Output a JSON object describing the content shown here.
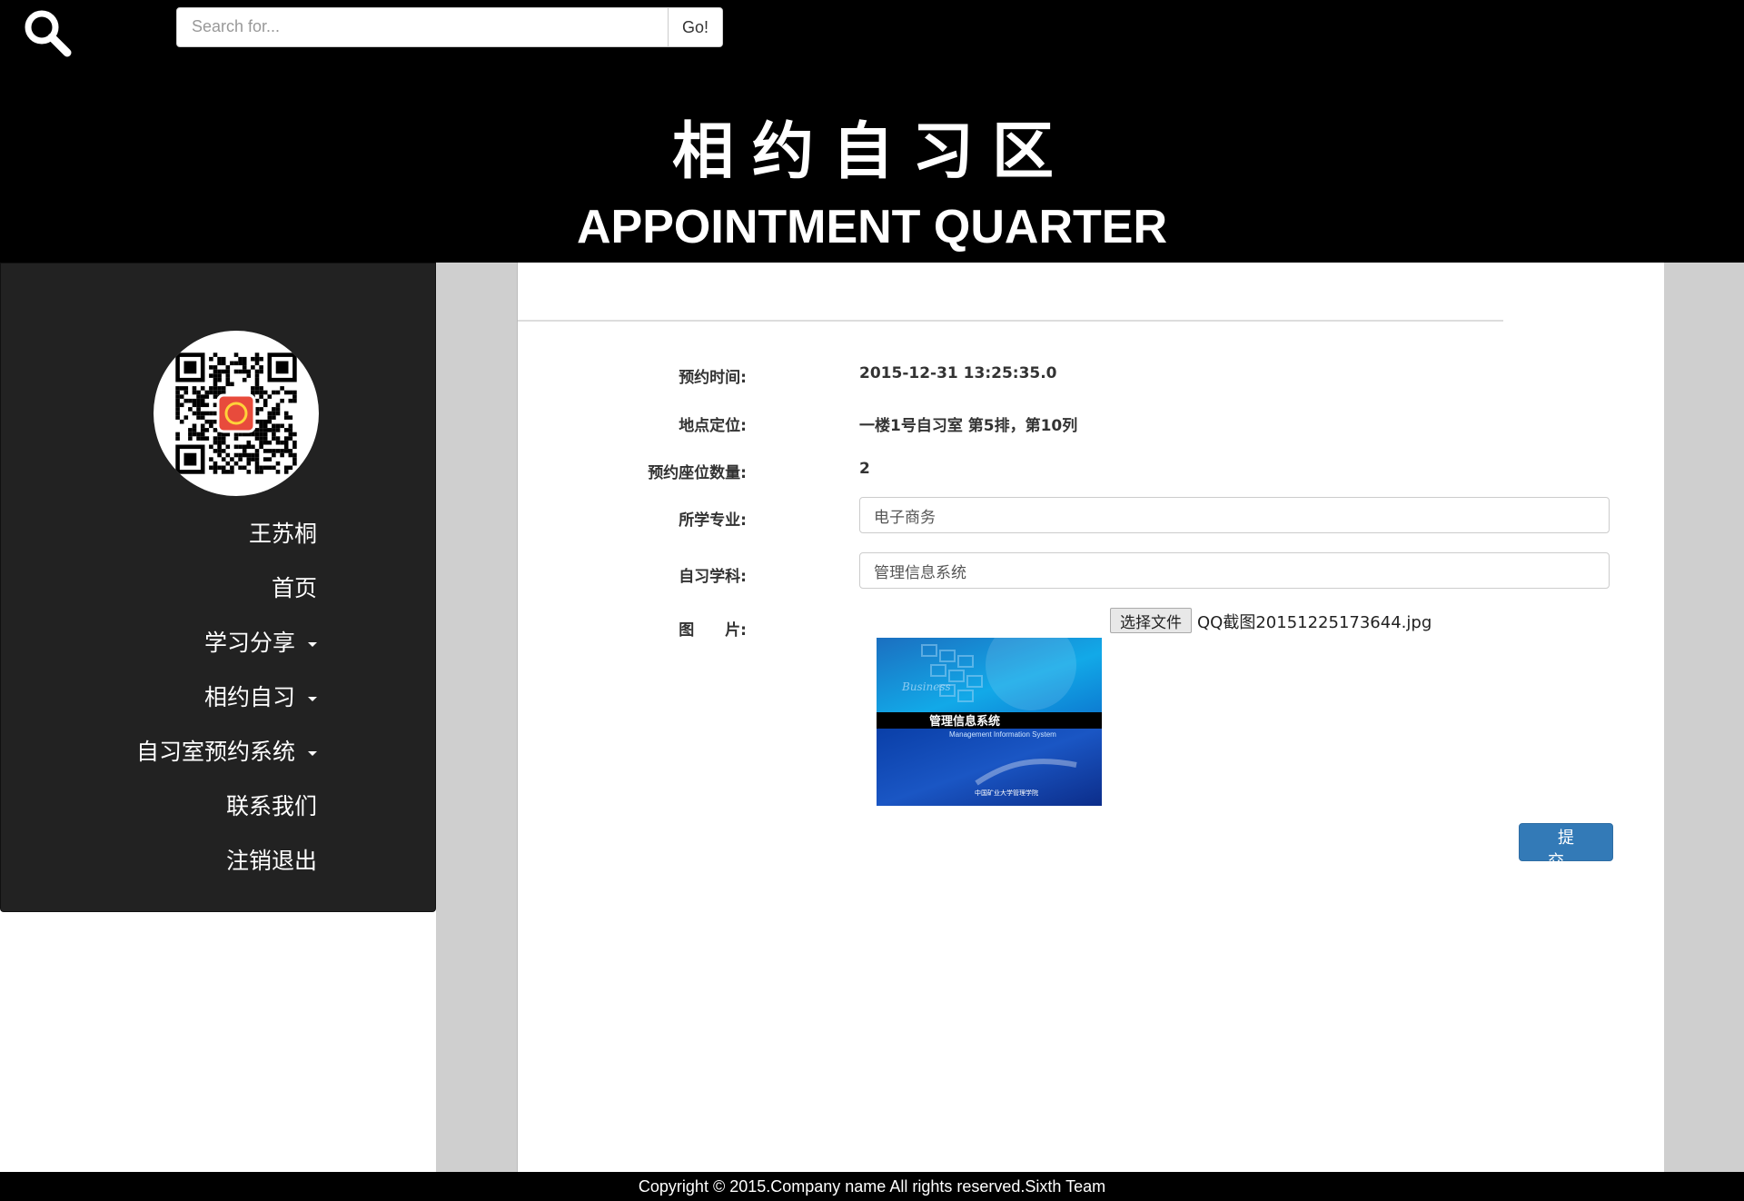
{
  "search": {
    "placeholder": "Search for...",
    "button_label": "Go!"
  },
  "header": {
    "title_cn": "相约自习区",
    "title_en": "APPOINTMENT QUARTER"
  },
  "sidebar": {
    "user_name": "王苏桐",
    "items": [
      {
        "label": "首页",
        "has_dropdown": false
      },
      {
        "label": "学习分享",
        "has_dropdown": true
      },
      {
        "label": "相约自习",
        "has_dropdown": true
      },
      {
        "label": "自习室预约系统",
        "has_dropdown": true
      },
      {
        "label": "联系我们",
        "has_dropdown": false
      },
      {
        "label": "注销退出",
        "has_dropdown": false
      }
    ]
  },
  "form": {
    "time_label": "预约时间:",
    "time_value": "2015-12-31 13:25:35.0",
    "location_label": "地点定位:",
    "location_value": "一楼1号自习室 第5排，第10列",
    "seats_label": "预约座位数量:",
    "seats_value": "2",
    "major_label": "所学专业:",
    "major_value": "电子商务",
    "subject_label": "自习学科:",
    "subject_value": "管理信息系统",
    "image_label": "图　　片:",
    "file_button_label": "选择文件",
    "file_name": "QQ截图20151225173644.jpg",
    "preview": {
      "title": "管理信息系统",
      "subtitle": "Management Information System",
      "footer": "中国矿业大学管理学院",
      "corner_text": "Business"
    },
    "submit_label": "提交"
  },
  "footer": {
    "copyright": "Copyright © 2015.Company name All rights reserved.Sixth Team"
  },
  "colors": {
    "header_bg": "#000000",
    "sidebar_bg": "#222222",
    "submit_bg": "#337ab7",
    "page_bg": "#cfcfcf"
  }
}
